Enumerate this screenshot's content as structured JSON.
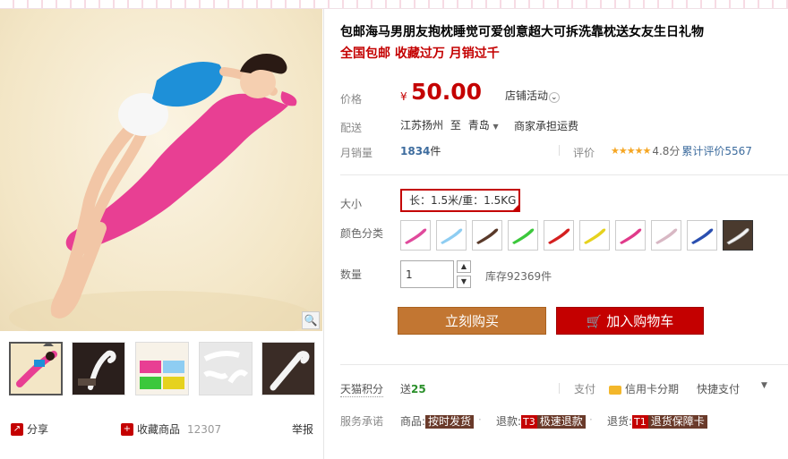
{
  "product": {
    "title": "包邮海马男朋友抱枕睡觉可爱创意超大可拆洗靠枕送女友生日礼物",
    "subtitle": "全国包邮 收藏过万 月销过千"
  },
  "price": {
    "label": "价格",
    "currency": "¥",
    "value": "50.00",
    "activity": "店铺活动"
  },
  "shipping": {
    "label": "配送",
    "from": "江苏扬州",
    "to_word": "至",
    "to": "青岛",
    "fee": "商家承担运费"
  },
  "sales": {
    "label": "月销量",
    "count": "1834",
    "unit": "件"
  },
  "review": {
    "label": "评价",
    "stars": "★★★★★",
    "score": "4.8分",
    "total": "累计评价5567",
    "rating": 4.8
  },
  "size": {
    "label": "大小",
    "selected": "长：1.5米/重：1.5KG"
  },
  "color": {
    "label": "颜色分类",
    "swatches": [
      {
        "icon": "pillow-pink-icon",
        "color": "#e04a9c"
      },
      {
        "icon": "pillow-lightblue-icon",
        "color": "#8ecdf2"
      },
      {
        "icon": "pillow-brown-icon",
        "color": "#5a3a2a"
      },
      {
        "icon": "pillow-green-icon",
        "color": "#3cc83c"
      },
      {
        "icon": "pillow-red-icon",
        "color": "#d42020"
      },
      {
        "icon": "pillow-yellow-icon",
        "color": "#e6d21e"
      },
      {
        "icon": "pillow-magenta-icon",
        "color": "#e03a8a"
      },
      {
        "icon": "pillow-silver-icon",
        "color": "#d8b8c4"
      },
      {
        "icon": "pillow-navy-icon",
        "color": "#2a4fb0"
      },
      {
        "icon": "pillow-white-icon",
        "color": "#f4f4f4"
      }
    ]
  },
  "quantity": {
    "label": "数量",
    "value": "1",
    "stock": "库存92369件"
  },
  "actions": {
    "buy": "立刻购买",
    "cart": "加入购物车"
  },
  "points": {
    "label": "天猫积分",
    "give": "送",
    "value": "25"
  },
  "payment": {
    "label": "支付",
    "credit": "信用卡分期",
    "quick": "快捷支付"
  },
  "service": {
    "label": "服务承诺",
    "goods_label": "商品:",
    "goods_tag": "按时发货",
    "refund_label": "退款:",
    "refund_code": "T3",
    "refund_tag": "极速退款",
    "return_label": "退货:",
    "return_code": "T1",
    "return_tag": "退货保障卡"
  },
  "gallery": {
    "share": "分享",
    "favorite": "收藏商品",
    "favorite_count": "12307",
    "report": "举报"
  }
}
